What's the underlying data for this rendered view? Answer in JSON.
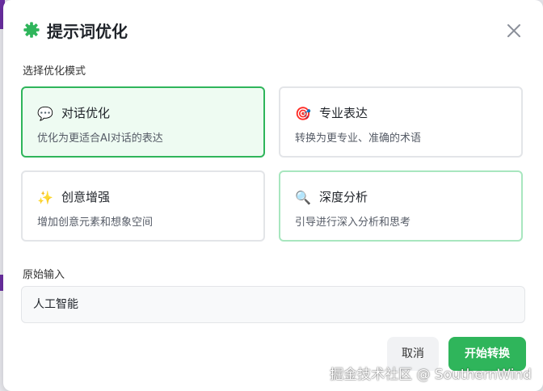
{
  "dialog": {
    "title": "提示词优化",
    "close_icon": "close-icon",
    "title_icon": "gear-icon",
    "accent_color": "#2fb55b"
  },
  "modes": {
    "label": "选择优化模式",
    "items": [
      {
        "icon": "💬",
        "icon_name": "speech-bubble-icon",
        "title": "对话优化",
        "desc": "优化为更适合AI对话的表达",
        "state": "selected"
      },
      {
        "icon": "🎯",
        "icon_name": "target-icon",
        "title": "专业表达",
        "desc": "转换为更专业、准确的术语",
        "state": "normal"
      },
      {
        "icon": "✨",
        "icon_name": "sparkles-icon",
        "title": "创意增强",
        "desc": "增加创意元素和想象空间",
        "state": "normal"
      },
      {
        "icon": "🔍",
        "icon_name": "magnifier-icon",
        "title": "深度分析",
        "desc": "引导进行深入分析和思考",
        "state": "hover"
      }
    ]
  },
  "input": {
    "label": "原始输入",
    "value": "人工智能"
  },
  "footer": {
    "cancel_label": "取消",
    "start_label": "开始转换"
  },
  "watermark": "掘金技术社区 @ SouthernWind"
}
